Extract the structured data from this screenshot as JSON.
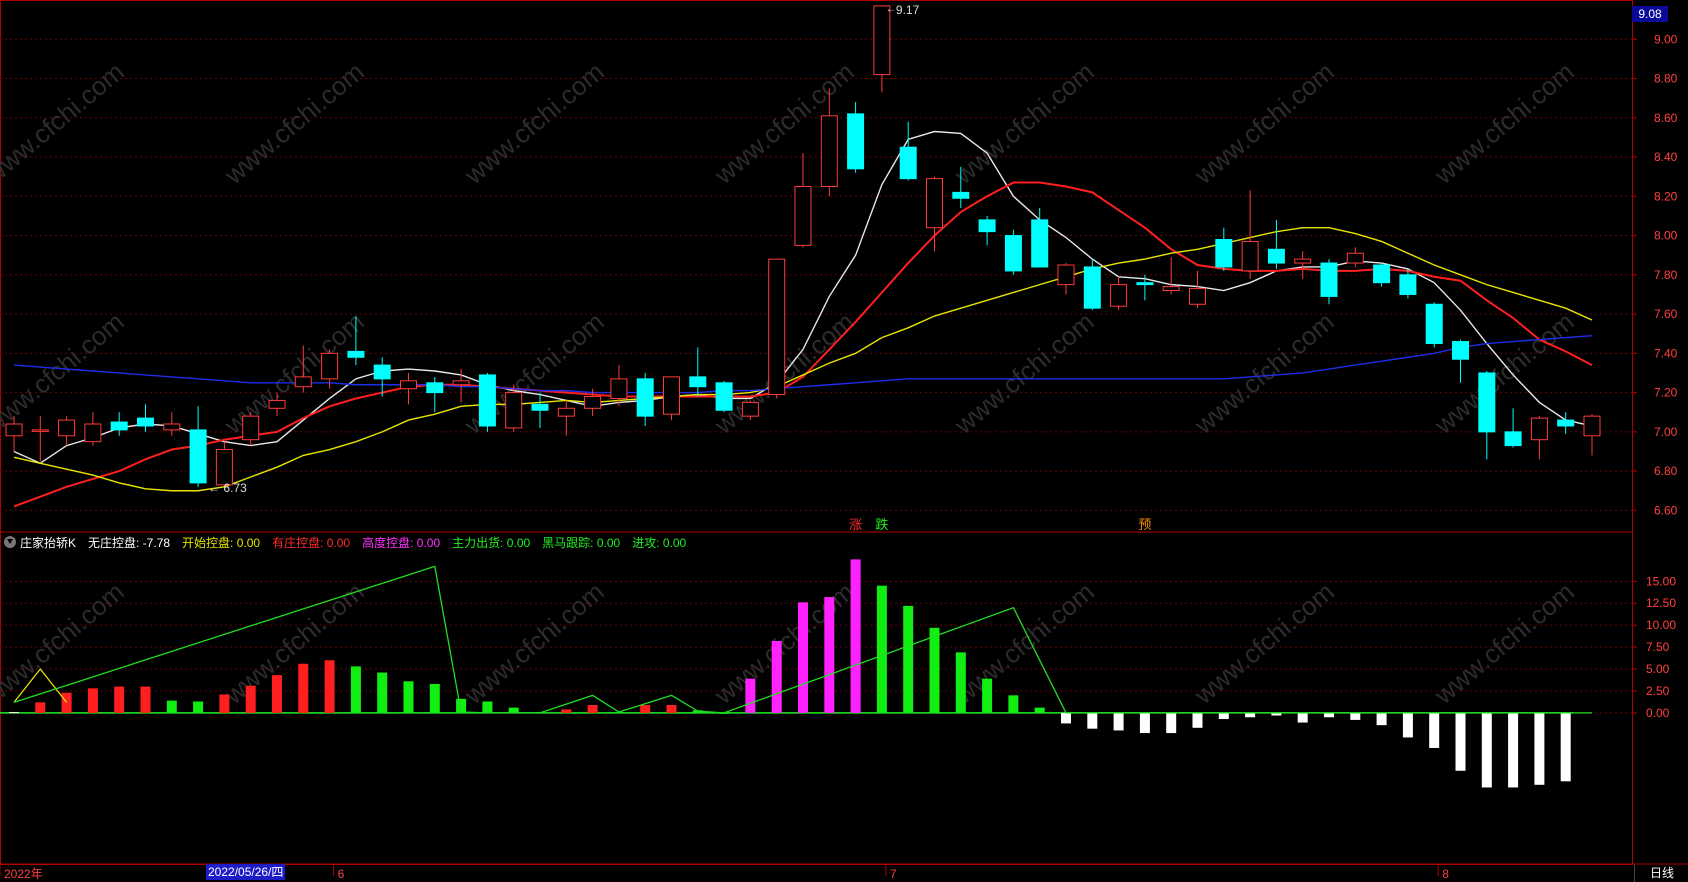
{
  "chart_data": [
    {
      "type": "candlestick",
      "panel": "price",
      "ylim": [
        6.5,
        9.2
      ],
      "y_ticks": [
        "6.60",
        "6.80",
        "7.00",
        "7.20",
        "7.40",
        "7.60",
        "7.80",
        "8.00",
        "8.20",
        "8.40",
        "8.60",
        "8.80",
        "9.00"
      ],
      "last_price_label": "9.08",
      "max_label": "9.17",
      "min_label": "6.73",
      "candles": [
        {
          "o": 6.98,
          "c": 7.04,
          "h": 7.08,
          "l": 6.9,
          "up": true
        },
        {
          "o": 7.01,
          "c": 7.01,
          "h": 7.08,
          "l": 6.85,
          "up": true
        },
        {
          "o": 6.98,
          "c": 7.06,
          "h": 7.08,
          "l": 6.93,
          "up": true
        },
        {
          "o": 6.95,
          "c": 7.04,
          "h": 7.1,
          "l": 6.93,
          "up": true
        },
        {
          "o": 7.05,
          "c": 7.01,
          "h": 7.1,
          "l": 6.98,
          "up": false
        },
        {
          "o": 7.07,
          "c": 7.03,
          "h": 7.14,
          "l": 7.0,
          "up": false
        },
        {
          "o": 7.01,
          "c": 7.04,
          "h": 7.1,
          "l": 6.98,
          "up": true
        },
        {
          "o": 7.01,
          "c": 6.74,
          "h": 7.13,
          "l": 6.72,
          "up": false
        },
        {
          "o": 6.73,
          "c": 6.91,
          "h": 6.95,
          "l": 6.73,
          "up": true
        },
        {
          "o": 6.96,
          "c": 7.08,
          "h": 7.1,
          "l": 6.93,
          "up": true
        },
        {
          "o": 7.12,
          "c": 7.16,
          "h": 7.2,
          "l": 7.08,
          "up": true
        },
        {
          "o": 7.23,
          "c": 7.28,
          "h": 7.44,
          "l": 7.2,
          "up": true
        },
        {
          "o": 7.27,
          "c": 7.4,
          "h": 7.42,
          "l": 7.22,
          "up": true
        },
        {
          "o": 7.41,
          "c": 7.38,
          "h": 7.59,
          "l": 7.34,
          "up": false
        },
        {
          "o": 7.34,
          "c": 7.27,
          "h": 7.38,
          "l": 7.18,
          "up": false
        },
        {
          "o": 7.22,
          "c": 7.26,
          "h": 7.3,
          "l": 7.14,
          "up": true
        },
        {
          "o": 7.25,
          "c": 7.2,
          "h": 7.28,
          "l": 7.1,
          "up": false
        },
        {
          "o": 7.24,
          "c": 7.26,
          "h": 7.32,
          "l": 7.15,
          "up": true
        },
        {
          "o": 7.29,
          "c": 7.03,
          "h": 7.3,
          "l": 7.0,
          "up": false
        },
        {
          "o": 7.02,
          "c": 7.2,
          "h": 7.24,
          "l": 7.0,
          "up": true
        },
        {
          "o": 7.14,
          "c": 7.11,
          "h": 7.2,
          "l": 7.02,
          "up": false
        },
        {
          "o": 7.08,
          "c": 7.12,
          "h": 7.16,
          "l": 6.98,
          "up": true
        },
        {
          "o": 7.12,
          "c": 7.18,
          "h": 7.22,
          "l": 7.08,
          "up": true
        },
        {
          "o": 7.17,
          "c": 7.27,
          "h": 7.34,
          "l": 7.13,
          "up": true
        },
        {
          "o": 7.27,
          "c": 7.08,
          "h": 7.3,
          "l": 7.03,
          "up": false
        },
        {
          "o": 7.09,
          "c": 7.28,
          "h": 7.28,
          "l": 7.06,
          "up": true
        },
        {
          "o": 7.28,
          "c": 7.23,
          "h": 7.43,
          "l": 7.18,
          "up": false
        },
        {
          "o": 7.25,
          "c": 7.11,
          "h": 7.26,
          "l": 7.1,
          "up": false
        },
        {
          "o": 7.08,
          "c": 7.15,
          "h": 7.16,
          "l": 7.06,
          "up": true
        },
        {
          "o": 7.19,
          "c": 7.88,
          "h": 7.88,
          "l": 7.17,
          "up": true
        },
        {
          "o": 7.95,
          "c": 8.25,
          "h": 8.42,
          "l": 7.94,
          "up": true
        },
        {
          "o": 8.25,
          "c": 8.61,
          "h": 8.75,
          "l": 8.2,
          "up": true
        },
        {
          "o": 8.62,
          "c": 8.34,
          "h": 8.68,
          "l": 8.32,
          "up": false
        },
        {
          "o": 8.82,
          "c": 9.17,
          "h": 9.17,
          "l": 8.73,
          "up": true
        },
        {
          "o": 8.45,
          "c": 8.29,
          "h": 8.58,
          "l": 8.28,
          "up": false
        },
        {
          "o": 8.04,
          "c": 8.29,
          "h": 8.3,
          "l": 7.92,
          "up": true
        },
        {
          "o": 8.22,
          "c": 8.19,
          "h": 8.35,
          "l": 8.14,
          "up": false
        },
        {
          "o": 8.08,
          "c": 8.02,
          "h": 8.1,
          "l": 7.95,
          "up": false
        },
        {
          "o": 8.0,
          "c": 7.82,
          "h": 8.03,
          "l": 7.8,
          "up": false
        },
        {
          "o": 8.08,
          "c": 7.84,
          "h": 8.14,
          "l": 7.84,
          "up": false
        },
        {
          "o": 7.75,
          "c": 7.85,
          "h": 7.86,
          "l": 7.7,
          "up": true
        },
        {
          "o": 7.84,
          "c": 7.63,
          "h": 7.88,
          "l": 7.62,
          "up": false
        },
        {
          "o": 7.64,
          "c": 7.75,
          "h": 7.79,
          "l": 7.62,
          "up": true
        },
        {
          "o": 7.76,
          "c": 7.75,
          "h": 7.8,
          "l": 7.67,
          "up": false
        },
        {
          "o": 7.72,
          "c": 7.74,
          "h": 7.89,
          "l": 7.7,
          "up": true
        },
        {
          "o": 7.65,
          "c": 7.73,
          "h": 7.82,
          "l": 7.63,
          "up": true
        },
        {
          "o": 7.98,
          "c": 7.84,
          "h": 8.04,
          "l": 7.82,
          "up": false
        },
        {
          "o": 7.82,
          "c": 7.97,
          "h": 8.23,
          "l": 7.78,
          "up": true
        },
        {
          "o": 7.93,
          "c": 7.86,
          "h": 8.08,
          "l": 7.83,
          "up": false
        },
        {
          "o": 7.86,
          "c": 7.88,
          "h": 7.92,
          "l": 7.78,
          "up": true
        },
        {
          "o": 7.86,
          "c": 7.69,
          "h": 7.88,
          "l": 7.65,
          "up": false
        },
        {
          "o": 7.86,
          "c": 7.91,
          "h": 7.94,
          "l": 7.84,
          "up": true
        },
        {
          "o": 7.85,
          "c": 7.76,
          "h": 7.86,
          "l": 7.74,
          "up": false
        },
        {
          "o": 7.8,
          "c": 7.7,
          "h": 7.83,
          "l": 7.68,
          "up": false
        },
        {
          "o": 7.65,
          "c": 7.45,
          "h": 7.66,
          "l": 7.43,
          "up": false
        },
        {
          "o": 7.46,
          "c": 7.37,
          "h": 7.47,
          "l": 7.25,
          "up": false
        },
        {
          "o": 7.3,
          "c": 7.0,
          "h": 7.31,
          "l": 6.86,
          "up": false
        },
        {
          "o": 7.0,
          "c": 6.93,
          "h": 7.12,
          "l": 6.92,
          "up": false
        },
        {
          "o": 6.96,
          "c": 7.07,
          "h": 7.08,
          "l": 6.86,
          "up": true
        },
        {
          "o": 7.06,
          "c": 7.03,
          "h": 7.1,
          "l": 6.99,
          "up": false
        },
        {
          "o": 6.98,
          "c": 7.08,
          "h": 7.09,
          "l": 6.88,
          "up": true
        }
      ],
      "ma_lines": [
        {
          "name": "MA5",
          "color": "#e8e8e8",
          "values": [
            6.9,
            6.84,
            6.93,
            6.97,
            7.02,
            7.04,
            7.03,
            6.99,
            6.95,
            6.93,
            6.95,
            7.06,
            7.17,
            7.27,
            7.31,
            7.32,
            7.31,
            7.29,
            7.24,
            7.21,
            7.19,
            7.16,
            7.13,
            7.15,
            7.16,
            7.18,
            7.19,
            7.17,
            7.17,
            7.25,
            7.42,
            7.69,
            7.9,
            8.26,
            8.49,
            8.53,
            8.52,
            8.42,
            8.2,
            8.08,
            7.99,
            7.88,
            7.79,
            7.78,
            7.75,
            7.74,
            7.72,
            7.76,
            7.82,
            7.84,
            7.84,
            7.87,
            7.86,
            7.83,
            7.76,
            7.62,
            7.45,
            7.29,
            7.15,
            7.06,
            7.03
          ]
        },
        {
          "name": "MA10",
          "color": "#ff1f1f",
          "values": [
            6.62,
            6.67,
            6.72,
            6.76,
            6.8,
            6.86,
            6.91,
            6.93,
            6.96,
            6.98,
            7.0,
            7.07,
            7.13,
            7.17,
            7.2,
            7.23,
            7.24,
            7.24,
            7.23,
            7.22,
            7.21,
            7.2,
            7.19,
            7.18,
            7.18,
            7.18,
            7.18,
            7.18,
            7.18,
            7.2,
            7.28,
            7.42,
            7.56,
            7.71,
            7.86,
            8.0,
            8.12,
            8.2,
            8.27,
            8.27,
            8.25,
            8.22,
            8.13,
            8.04,
            7.93,
            7.85,
            7.83,
            7.82,
            7.82,
            7.83,
            7.82,
            7.82,
            7.83,
            7.82,
            7.79,
            7.77,
            7.67,
            7.58,
            7.47,
            7.41,
            7.34
          ]
        },
        {
          "name": "MA20",
          "color": "#e6e600",
          "values": [
            6.87,
            6.84,
            6.81,
            6.78,
            6.74,
            6.71,
            6.7,
            6.7,
            6.72,
            6.77,
            6.82,
            6.88,
            6.91,
            6.95,
            7.0,
            7.06,
            7.09,
            7.13,
            7.14,
            7.14,
            7.15,
            7.16,
            7.15,
            7.16,
            7.17,
            7.18,
            7.19,
            7.19,
            7.2,
            7.23,
            7.29,
            7.35,
            7.4,
            7.48,
            7.53,
            7.59,
            7.63,
            7.67,
            7.71,
            7.75,
            7.79,
            7.83,
            7.86,
            7.88,
            7.91,
            7.93,
            7.96,
            7.99,
            8.02,
            8.04,
            8.04,
            8.01,
            7.97,
            7.91,
            7.85,
            7.8,
            7.75,
            7.71,
            7.67,
            7.63,
            7.57
          ]
        },
        {
          "name": "MA60",
          "color": "#1e2ee8",
          "values": [
            7.34,
            7.33,
            7.32,
            7.31,
            7.3,
            7.29,
            7.28,
            7.27,
            7.26,
            7.25,
            7.25,
            7.25,
            7.25,
            7.24,
            7.24,
            7.24,
            7.24,
            7.23,
            7.23,
            7.22,
            7.21,
            7.21,
            7.2,
            7.2,
            7.2,
            7.2,
            7.2,
            7.21,
            7.21,
            7.22,
            7.23,
            7.24,
            7.25,
            7.26,
            7.27,
            7.27,
            7.27,
            7.27,
            7.27,
            7.27,
            7.27,
            7.27,
            7.27,
            7.27,
            7.27,
            7.27,
            7.27,
            7.28,
            7.29,
            7.3,
            7.32,
            7.34,
            7.36,
            7.38,
            7.4,
            7.43,
            7.45,
            7.46,
            7.47,
            7.48,
            7.49
          ]
        }
      ],
      "markers": [
        {
          "text": "涨",
          "index": 32,
          "color": "#ff2a2a"
        },
        {
          "text": "跌",
          "index": 33,
          "color": "#22ee22"
        },
        {
          "text": "预",
          "index": 43,
          "color": "#ff8c00"
        }
      ]
    },
    {
      "type": "bar",
      "panel": "indicator",
      "ylim": [
        -17,
        18
      ],
      "y_ticks": [
        "0.00",
        "2.50",
        "5.00",
        "7.50",
        "10.00",
        "12.50",
        "15.00"
      ],
      "bars": [
        {
          "v": 0.1,
          "c": "white"
        },
        {
          "v": 1.2,
          "c": "red"
        },
        {
          "v": 2.3,
          "c": "red"
        },
        {
          "v": 2.8,
          "c": "red"
        },
        {
          "v": 3.0,
          "c": "red"
        },
        {
          "v": 3.0,
          "c": "red"
        },
        {
          "v": 1.4,
          "c": "green"
        },
        {
          "v": 1.3,
          "c": "green"
        },
        {
          "v": 2.1,
          "c": "red"
        },
        {
          "v": 3.1,
          "c": "red"
        },
        {
          "v": 4.3,
          "c": "red"
        },
        {
          "v": 5.6,
          "c": "red"
        },
        {
          "v": 6.0,
          "c": "red"
        },
        {
          "v": 5.3,
          "c": "green"
        },
        {
          "v": 4.6,
          "c": "green"
        },
        {
          "v": 3.6,
          "c": "green"
        },
        {
          "v": 3.3,
          "c": "green"
        },
        {
          "v": 1.6,
          "c": "green"
        },
        {
          "v": 1.3,
          "c": "green"
        },
        {
          "v": 0.6,
          "c": "green"
        },
        {
          "v": 0.1,
          "c": "green"
        },
        {
          "v": 0.4,
          "c": "red"
        },
        {
          "v": 0.9,
          "c": "red"
        },
        {
          "v": 0.1,
          "c": "green"
        },
        {
          "v": 0.9,
          "c": "red"
        },
        {
          "v": 0.9,
          "c": "red"
        },
        {
          "v": 0.3,
          "c": "green"
        },
        {
          "v": 0.0,
          "c": "green"
        },
        {
          "v": 3.9,
          "c": "magenta"
        },
        {
          "v": 8.2,
          "c": "magenta"
        },
        {
          "v": 12.6,
          "c": "magenta"
        },
        {
          "v": 13.2,
          "c": "magenta"
        },
        {
          "v": 17.5,
          "c": "magenta"
        },
        {
          "v": 14.5,
          "c": "green"
        },
        {
          "v": 12.2,
          "c": "green"
        },
        {
          "v": 9.7,
          "c": "green"
        },
        {
          "v": 6.9,
          "c": "green"
        },
        {
          "v": 3.9,
          "c": "green"
        },
        {
          "v": 2.0,
          "c": "green"
        },
        {
          "v": 0.6,
          "c": "green"
        },
        {
          "v": -1.2,
          "c": "white"
        },
        {
          "v": -1.8,
          "c": "white"
        },
        {
          "v": -2.0,
          "c": "white"
        },
        {
          "v": -2.3,
          "c": "white"
        },
        {
          "v": -2.3,
          "c": "white"
        },
        {
          "v": -1.7,
          "c": "white"
        },
        {
          "v": -0.7,
          "c": "white"
        },
        {
          "v": -0.5,
          "c": "white"
        },
        {
          "v": -0.3,
          "c": "white"
        },
        {
          "v": -1.1,
          "c": "white"
        },
        {
          "v": -0.5,
          "c": "white"
        },
        {
          "v": -0.8,
          "c": "white"
        },
        {
          "v": -1.4,
          "c": "white"
        },
        {
          "v": -2.8,
          "c": "white"
        },
        {
          "v": -4.0,
          "c": "white"
        },
        {
          "v": -6.6,
          "c": "white"
        },
        {
          "v": -8.5,
          "c": "white"
        },
        {
          "v": -8.5,
          "c": "white"
        },
        {
          "v": -8.2,
          "c": "white"
        },
        {
          "v": -7.8,
          "c": "white"
        }
      ],
      "lines": [
        {
          "name": "黄线",
          "color": "#e6e600",
          "points": [
            [
              0,
              1.2
            ],
            [
              1,
              5.0
            ],
            [
              2,
              1.2
            ]
          ]
        },
        {
          "name": "绿线",
          "color": "#22dd22",
          "points": [
            [
              0,
              1.2
            ],
            [
              16,
              16.7
            ],
            [
              17,
              0.1
            ],
            [
              18,
              0.0
            ],
            [
              19,
              0.0
            ],
            [
              20,
              0.0
            ],
            [
              22,
              2.0
            ],
            [
              23,
              0.1
            ],
            [
              25,
              2.0
            ],
            [
              26,
              0.2
            ],
            [
              27,
              0.0
            ],
            [
              38,
              12.0
            ],
            [
              40,
              0.0
            ],
            [
              60,
              0.0
            ]
          ]
        }
      ]
    }
  ],
  "indicator_header": {
    "name": "庄家抬轿K",
    "items": [
      {
        "label": "无庄控盘: -7.78",
        "color": "#ffffff"
      },
      {
        "label": "开始控盘: 0.00",
        "color": "#e6e600"
      },
      {
        "label": "有庄控盘: 0.00",
        "color": "#ff2a2a"
      },
      {
        "label": "高度控盘: 0.00",
        "color": "#ff33ff"
      },
      {
        "label": "主力出货: 0.00",
        "color": "#22ee22"
      },
      {
        "label": "黑马跟踪: 0.00",
        "color": "#22ee22"
      },
      {
        "label": "进攻: 0.00",
        "color": "#22ee22"
      }
    ]
  },
  "x_axis": {
    "labels": [
      {
        "text": "2022年",
        "index": 0
      },
      {
        "text": "6",
        "index": 12
      },
      {
        "text": "7",
        "index": 33
      },
      {
        "text": "8",
        "index": 54
      }
    ],
    "date_flag": "2022/05/26/四"
  },
  "period_tab": "日线",
  "watermark": "www.cfchi.com",
  "colors": {
    "up": "#ff3b3b",
    "down": "#00ffff",
    "grid": "#6a0000",
    "axis": "#b00000",
    "bg": "#000000"
  }
}
